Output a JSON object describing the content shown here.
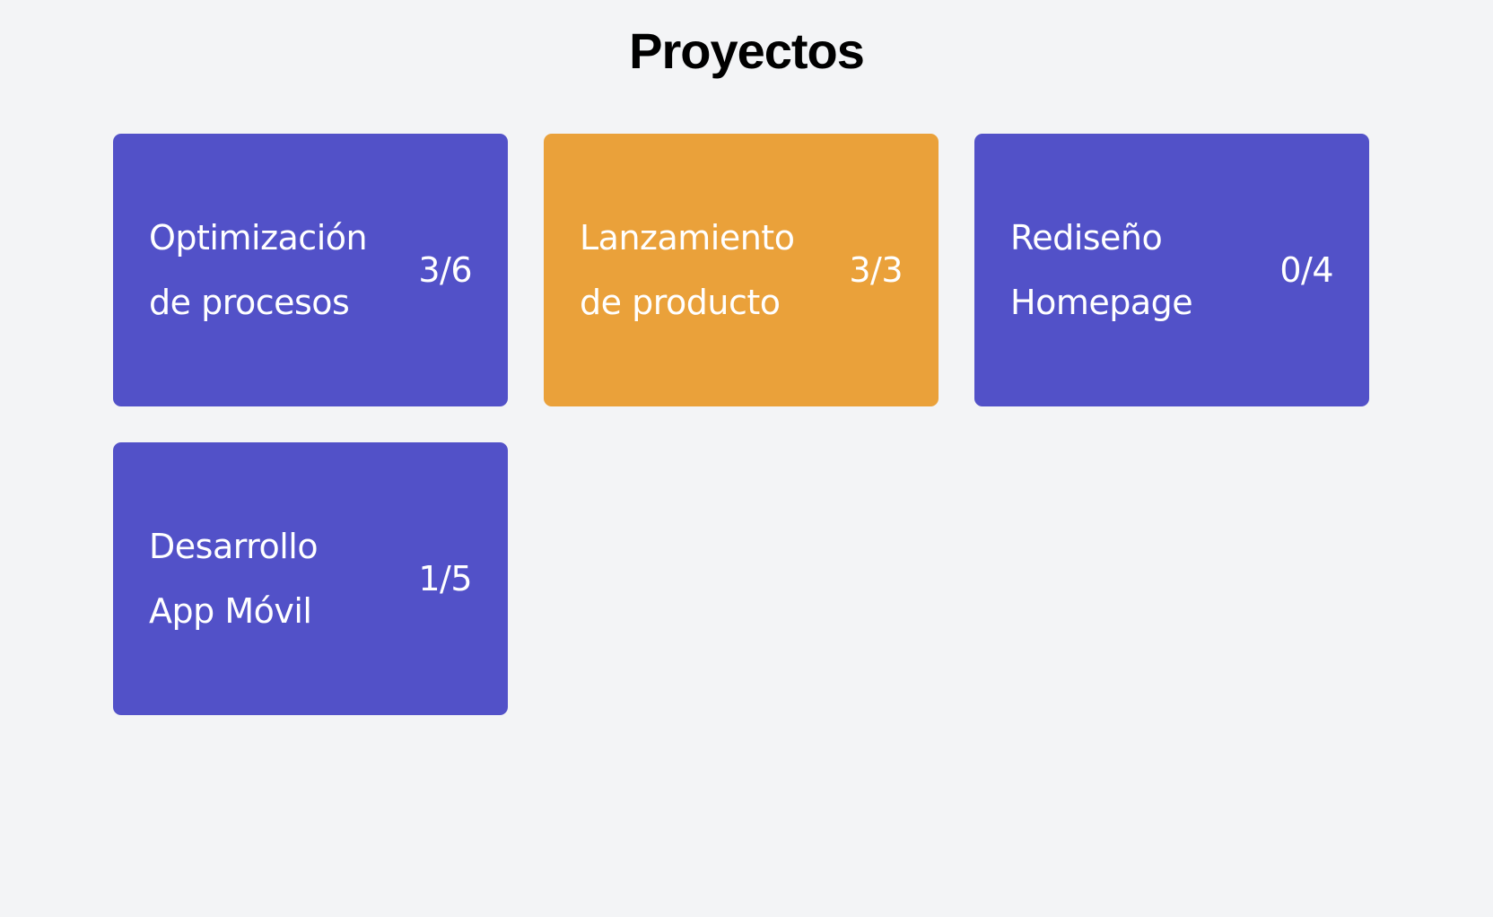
{
  "page": {
    "title": "Proyectos"
  },
  "colors": {
    "background": "#f3f4f6",
    "card_default": "#5251c8",
    "card_complete": "#eaa13a",
    "text_light": "#ffffff"
  },
  "projects": [
    {
      "name": "Optimización de procesos",
      "count": "3/6",
      "status": "in-progress"
    },
    {
      "name": "Lanzamiento de producto",
      "count": "3/3",
      "status": "complete"
    },
    {
      "name": "Rediseño Homepage",
      "count": "0/4",
      "status": "in-progress"
    },
    {
      "name": "Desarrollo App Móvil",
      "count": "1/5",
      "status": "in-progress"
    }
  ]
}
